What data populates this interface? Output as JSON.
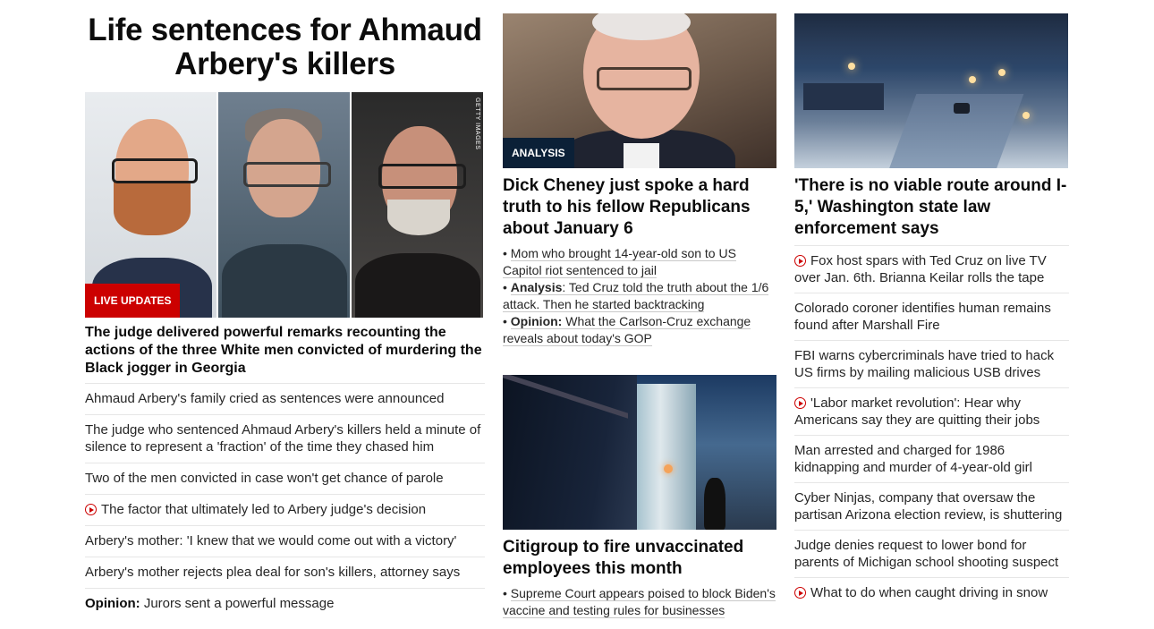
{
  "lead": {
    "title": "Life sentences for Ahmaud Arbery's killers",
    "image_credit": "GETTY IMAGES",
    "badge": "LIVE UPDATES",
    "headline": "The judge delivered powerful remarks recounting the actions of the three White men convicted of murdering the Black jogger in Georgia",
    "links": [
      {
        "text": "Ahmaud Arbery's family cried as sentences were announced",
        "video": false,
        "prefix": ""
      },
      {
        "text": "The judge who sentenced Ahmaud Arbery's killers held a minute of silence to represent a 'fraction' of the time they chased him",
        "video": false,
        "prefix": ""
      },
      {
        "text": "Two of the men convicted in case won't get chance of parole",
        "video": false,
        "prefix": ""
      },
      {
        "text": "The factor that ultimately led to Arbery judge's decision",
        "video": true,
        "prefix": ""
      },
      {
        "text": "Arbery's mother: 'I knew that we would come out with a victory'",
        "video": false,
        "prefix": ""
      },
      {
        "text": "Arbery's mother rejects plea deal for son's killers, attorney says",
        "video": false,
        "prefix": ""
      },
      {
        "text": "Jurors sent a powerful message",
        "video": false,
        "prefix": "Opinion:"
      }
    ]
  },
  "cheney": {
    "badge": "ANALYSIS",
    "headline": "Dick Cheney just spoke a hard truth to his fellow Republicans about January 6",
    "bullets": [
      {
        "prefix": "",
        "text": "Mom who brought 14-year-old son to US Capitol riot sentenced to jail"
      },
      {
        "prefix": "Analysis",
        "text": ": Ted Cruz told the truth about the 1/6 attack. Then he started backtracking"
      },
      {
        "prefix": "Opinion:",
        "text": " What the Carlson-Cruz exchange reveals about today's GOP"
      }
    ]
  },
  "citi": {
    "headline": "Citigroup to fire unvaccinated employees this month",
    "bullets": [
      {
        "prefix": "",
        "text": "Supreme Court appears poised to block Biden's vaccine and testing rules for businesses"
      }
    ]
  },
  "washington": {
    "headline": "'There is no viable route around I-5,' Washington state law enforcement says",
    "links": [
      {
        "text": "Fox host spars with Ted Cruz on live TV over Jan. 6th. Brianna Keilar rolls the tape",
        "video": true
      },
      {
        "text": "Colorado coroner identifies human remains found after Marshall Fire",
        "video": false
      },
      {
        "text": "FBI warns cybercriminals have tried to hack US firms by mailing malicious USB drives",
        "video": false
      },
      {
        "text": "'Labor market revolution': Hear why Americans say they are quitting their jobs",
        "video": true
      },
      {
        "text": "Man arrested and charged for 1986 kidnapping and murder of 4-year-old girl",
        "video": false
      },
      {
        "text": "Cyber Ninjas, company that oversaw the partisan Arizona election review, is shuttering",
        "video": false
      },
      {
        "text": "Judge denies request to lower bond for parents of Michigan school shooting suspect",
        "video": false
      },
      {
        "text": "What to do when caught driving in snow",
        "video": true
      }
    ]
  },
  "colors": {
    "accent_red": "#cc0000",
    "analysis_navy": "#0b2037",
    "divider": "#e6e6e6"
  }
}
